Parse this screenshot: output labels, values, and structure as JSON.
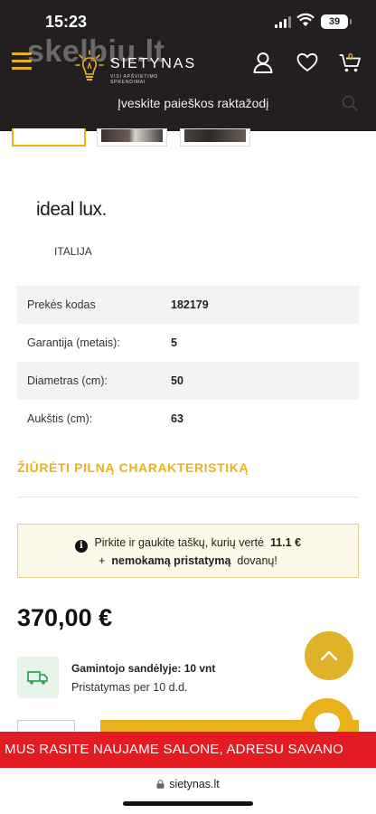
{
  "status_bar": {
    "time": "15:23",
    "battery": "39"
  },
  "header": {
    "watermark": "skelbiu.lt",
    "logo_name": "SIETYNAS",
    "logo_tagline": "VISI APŠVIETIMO SPRENDIMAI",
    "cart_count": "0",
    "search_placeholder": "Įveskite paieškos raktažodį",
    "accent_color": "#e9b21c"
  },
  "brand": {
    "name": "ideal lux.",
    "country": "ITALIJA"
  },
  "specs": [
    {
      "label": "Prekės kodas",
      "value": "182179"
    },
    {
      "label": "Garantija (metais):",
      "value": "5"
    },
    {
      "label": "Diametras (cm):",
      "value": "50"
    },
    {
      "label": "Aukštis (cm):",
      "value": "63"
    }
  ],
  "full_spec_link": "ŽIŪRĖTI PILNĄ CHARAKTERISTIKĄ",
  "points": {
    "text_before": "Pirkite ir gaukite taškų, kurių vertė",
    "value": "11.1 €",
    "plus": "+",
    "delivery_bold": "nemokamą pristatymą",
    "delivery_suffix": "dovanų!"
  },
  "price": "370,00 €",
  "stock": {
    "label": "Gamintojo sandėlyje: 10 vnt",
    "delivery": "Pristatymas per 10 d.d."
  },
  "marquee_text": "MUS RASITE NAUJAME SALONE, ADRESU SAVANO",
  "browser": {
    "url": "sietynas.lt"
  },
  "icons": [
    "menu-icon",
    "user-icon",
    "heart-icon",
    "cart-icon",
    "search-icon",
    "info-icon",
    "truck-icon",
    "chevron-up-icon",
    "chat-icon",
    "lock-icon"
  ]
}
